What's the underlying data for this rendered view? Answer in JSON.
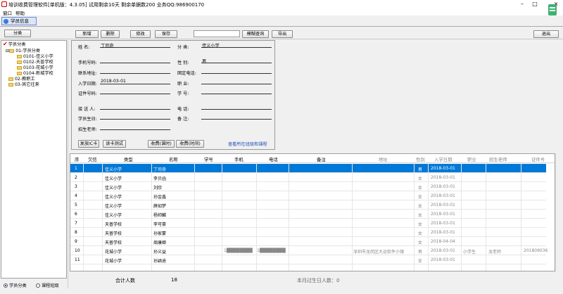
{
  "window": {
    "title": "培训收费管理软件[单机版：4.3.05]     试用剩余10天   剩余单据数200           业务QQ:986900170"
  },
  "menu": [
    "窗口",
    "帮助"
  ],
  "tab": {
    "label": "学员信息"
  },
  "toolbar": {
    "category_btn": "分类",
    "add": "新增",
    "delete": "删除",
    "edit": "修改",
    "save": "保存",
    "search_value": "",
    "fuzzy_search": "模糊查询",
    "export": "导出",
    "exit": "退出"
  },
  "tree": {
    "root": "学员分类",
    "n01": "01-学员分类",
    "n0101": "0101-佳义小学",
    "n0102": "0102-天普学校",
    "n0103": "0103-花城小学",
    "n0104": "0104-新城学校",
    "n02": "02-教职工",
    "n03": "03-其它往来"
  },
  "left_footer": {
    "by_category": "学员分类",
    "by_course": "课程班级"
  },
  "form": {
    "name_label": "姓    名:",
    "name_value": "丁司奇",
    "category_label": "分    类:",
    "category_value": "佳义小学",
    "phone_label": "手机号码:",
    "phone_value": "",
    "gender_label": "性    别:",
    "gender_value": "男",
    "address_label": "联系地址:",
    "address_value": "",
    "landline_label": "固定电话:",
    "landline_value": "",
    "enroll_label": "入学日期:",
    "enroll_value": "2018-03-01",
    "job_label": "职    业:",
    "job_value": "",
    "id_label": "证件号码:",
    "id_value": "",
    "studentno_label": "学    号:",
    "studentno_value": "",
    "pickup_label": "接 送 人:",
    "pickup_value": "",
    "tel_label": "电    话:",
    "tel_value": "",
    "birthday_label": "学员生日:",
    "birthday_value": "",
    "remark_label": "备    注:",
    "remark_value": "",
    "teacher_label": "招生老师:",
    "teacher_value": "",
    "issue_card": "发放IC卡",
    "read_card": "读卡测试",
    "charge_class": "收费(课时)",
    "charge_time": "收费(时间)",
    "view_courses": "查看所在班级和课程"
  },
  "grid": {
    "headers": [
      "序",
      "欠信",
      "类型",
      "名称",
      "学号",
      "手机",
      "电话",
      "备注",
      "地址",
      "性别",
      "入学日期",
      "职业",
      "招生老师",
      "证件号"
    ],
    "rows": [
      {
        "no": "1",
        "type": "佳义小学",
        "name": "丁司奇",
        "gender": "男",
        "date": "2018-03-01"
      },
      {
        "no": "2",
        "type": "佳义小学",
        "name": "李贝函",
        "gender": "女",
        "date": "2018-03-01"
      },
      {
        "no": "3",
        "type": "佳义小学",
        "name": "刘欣",
        "gender": "女",
        "date": "2018-03-01"
      },
      {
        "no": "4",
        "type": "佳义小学",
        "name": "孙金鑫",
        "gender": "女",
        "date": "2018-03-01"
      },
      {
        "no": "5",
        "type": "佳义小学",
        "name": "薛如梦",
        "gender": "女",
        "date": "2018-03-01"
      },
      {
        "no": "6",
        "type": "佳义小学",
        "name": "杨帅麟",
        "gender": "女",
        "date": "2018-03-01"
      },
      {
        "no": "7",
        "type": "天普学校",
        "name": "李可豪",
        "gender": "女",
        "date": "2018-03-01"
      },
      {
        "no": "8",
        "type": "天普学校",
        "name": "孙家蒙",
        "gender": "女",
        "date": "2018-03-01"
      },
      {
        "no": "9",
        "type": "天普学校",
        "name": "周康卿",
        "gender": "女",
        "date": "2018-04-04"
      },
      {
        "no": "10",
        "type": "花城小学",
        "name": "孙义益",
        "phone": "1████████",
        "tel": "1████████",
        "addr": "深圳市龙岗区大运软件小镇",
        "gender": "男",
        "date": "2018-03-01",
        "job": "小学生",
        "teacher": "龙老师",
        "idno": "201809036"
      },
      {
        "no": "11",
        "type": "花城小学",
        "name": "孙颖迪",
        "gender": "女",
        "date": "2018-03-01"
      }
    ]
  },
  "summary": {
    "total_label": "合计人数",
    "total_value": "18",
    "birthday_label": "本月过生日人数：0"
  },
  "colors": {
    "selection": "#0078d7",
    "tree_check": "#dd0000",
    "folder": "#f5d372"
  }
}
